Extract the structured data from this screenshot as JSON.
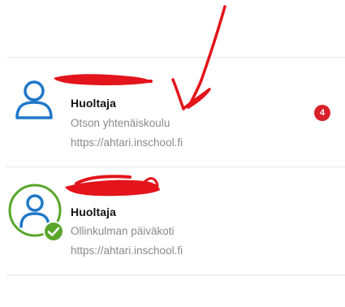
{
  "accounts": [
    {
      "role": "Huoltaja",
      "school": "Otson yhtenäiskoulu",
      "url": "https://ahtari.inschool.fi",
      "unread_count": "4",
      "selected": false
    },
    {
      "role": "Huoltaja",
      "school": "Ollinkulman päiväkoti",
      "url": "https://ahtari.inschool.fi",
      "selected": true
    }
  ],
  "colors": {
    "avatar_blue": "#1f78c8",
    "active_green": "#5aa62a",
    "badge_red": "#d9202a",
    "annotation_red": "#e3141b"
  },
  "icons": {
    "avatar": "person-outline-icon",
    "active": "check-circle-icon"
  }
}
